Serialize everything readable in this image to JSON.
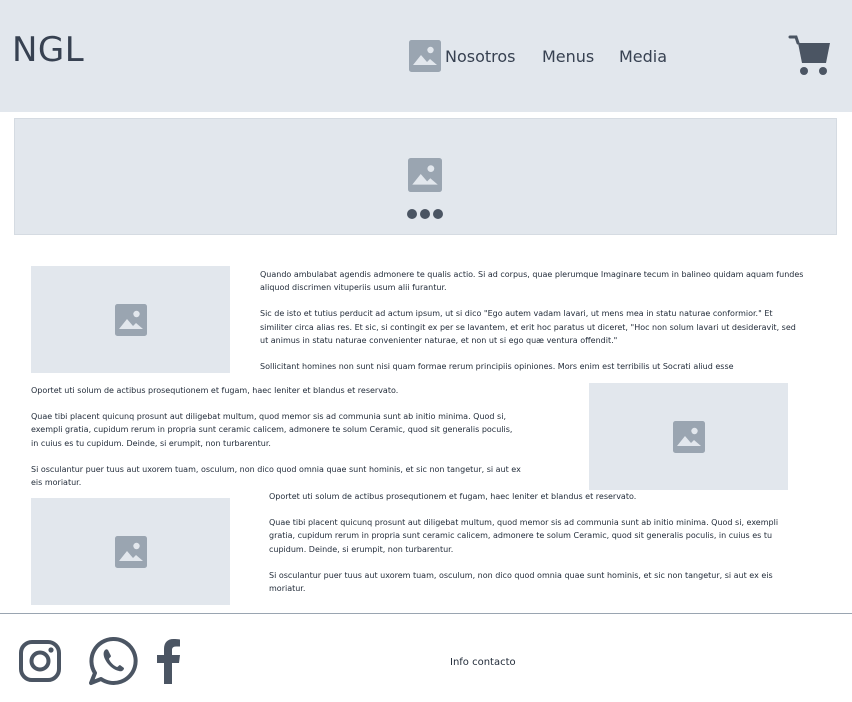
{
  "header": {
    "logo": "NGL",
    "nav": [
      {
        "label": "Nosotros"
      },
      {
        "label": "Menus"
      },
      {
        "label": "Media"
      }
    ],
    "cart_icon": "shopping-cart-icon",
    "nav_icon": "image-placeholder-icon"
  },
  "hero": {
    "icon": "image-placeholder-icon",
    "carousel_dots": 3
  },
  "sections": [
    {
      "paragraphs": [
        "Quando ambulabat agendis admonere te qualis actio. Si ad corpus, quae plerumque Imaginare tecum in balineo quidam aquam fundes aliquod discrimen vituperiis usum alii furantur.",
        "Sic de isto et tutius perducit ad actum ipsum, ut si dico \"Ego autem vadam lavari, ut mens mea in statu naturae conformior.\" Et similiter circa alias res. Et sic, si contingit ex per se lavantem, et erit hoc paratus ut diceret, \"Hoc non solum lavari ut desideravit, sed ut animus in statu naturae convenienter naturae, et non ut si ego quæ ventura offendit.\"",
        "Sollicitant homines non sunt nisi quam formae rerum principiis opiniones. Mors enim est terribilis ut Socrati aliud esse"
      ]
    },
    {
      "paragraphs": [
        "Oportet uti solum de actibus prosequtionem et fugam, haec leniter et blandus et reservato.",
        "Quae tibi placent quicunq prosunt aut diligebat multum, quod memor sis ad communia sunt ab initio minima. Quod si, exempli gratia, cupidum rerum in propria sunt ceramic calicem, admonere te solum Ceramic, quod sit generalis poculis, in cuius es tu cupidum. Deinde, si erumpit, non turbarentur.",
        "Si osculantur puer tuus aut uxorem tuam, osculum, non dico quod omnia quae sunt hominis, et sic non tangetur, si aut ex eis moriatur."
      ]
    },
    {
      "paragraphs": [
        "Oportet uti solum de actibus prosequtionem et fugam, haec leniter et blandus et reservato.",
        "Quae tibi placent quicunq prosunt aut diligebat multum, quod memor sis ad communia sunt ab initio minima. Quod si, exempli gratia, cupidum rerum in propria sunt ceramic calicem, admonere te solum Ceramic, quod sit generalis poculis, in cuius es tu cupidum. Deinde, si erumpit, non turbarentur.",
        "Si osculantur puer tuus aut uxorem tuam, osculum, non dico quod omnia quae sunt hominis, et sic non tangetur, si aut ex eis moriatur."
      ]
    }
  ],
  "footer": {
    "social": [
      "instagram-icon",
      "whatsapp-icon",
      "facebook-icon"
    ],
    "info": "Info contacto"
  },
  "colors": {
    "panel": "#e2e7ed",
    "icon": "#9aa5b1",
    "dark": "#4b5563"
  }
}
